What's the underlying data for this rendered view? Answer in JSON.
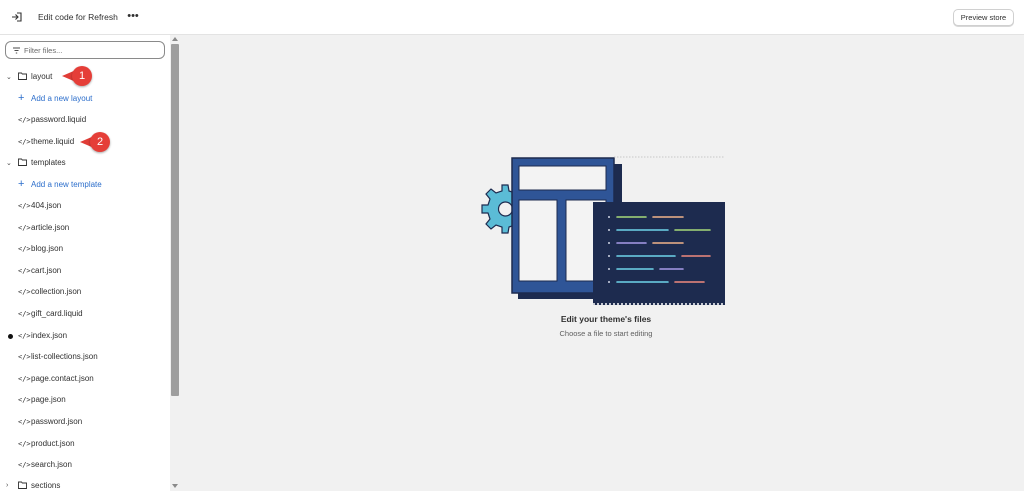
{
  "header": {
    "title": "Edit code for Refresh",
    "more_label": "•••",
    "preview_label": "Preview store"
  },
  "sidebar": {
    "filter_placeholder": "Filter files...",
    "layout_folder": "layout",
    "add_layout": "Add a new layout",
    "layout_files": [
      "password.liquid",
      "theme.liquid"
    ],
    "templates_folder": "templates",
    "add_template": "Add a new template",
    "template_files": [
      "404.json",
      "article.json",
      "blog.json",
      "cart.json",
      "collection.json",
      "gift_card.liquid",
      "index.json",
      "list-collections.json",
      "page.contact.json",
      "page.json",
      "password.json",
      "product.json",
      "search.json"
    ],
    "sections_folder": "sections"
  },
  "callouts": [
    "1",
    "2"
  ],
  "empty_state": {
    "title": "Edit your theme's files",
    "subtitle": "Choose a file to start editing"
  },
  "colors": {
    "accent": "#2c6ecb",
    "callout": "#e53e38",
    "illustration_blue": "#2f5597",
    "illustration_dark": "#1d2b4f",
    "gear": "#5bbcd6"
  }
}
